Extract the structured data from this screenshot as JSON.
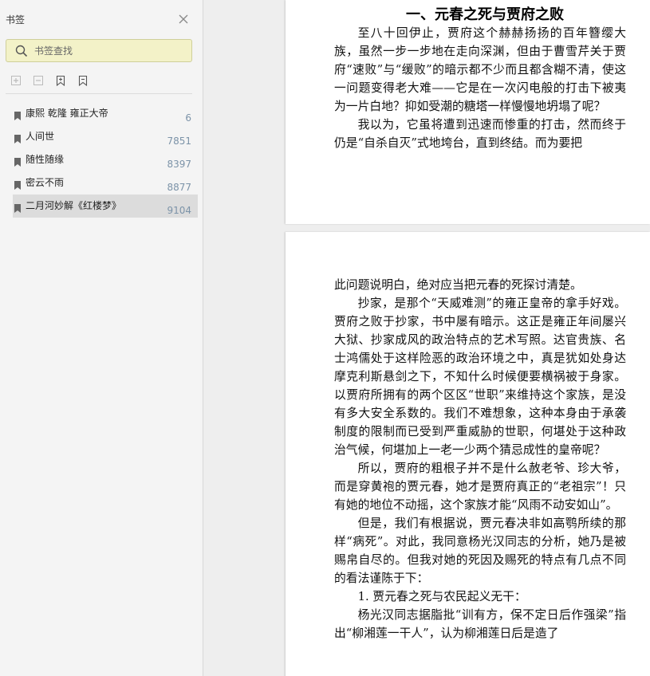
{
  "sidebar": {
    "title": "书签",
    "search_placeholder": "书签查找",
    "bookmarks": [
      {
        "label": "康熙 乾隆 雍正大帝",
        "page": "6"
      },
      {
        "label": "人间世",
        "page": "7851"
      },
      {
        "label": "随性随缘",
        "page": "8397"
      },
      {
        "label": "密云不雨",
        "page": "8877"
      },
      {
        "label": "二月河妙解《红楼梦》",
        "page": "9104"
      }
    ]
  },
  "page1": {
    "title": "一、元春之死与贾府之败",
    "paragraphs": [
      "至八十回伊止，贾府这个赫赫扬扬的百年簪缨大族，虽然一步一步地在走向深渊，但由于曹雪芹关于贾府“速败”与“缓败”的暗示都不少而且都含糊不清，使这一问题变得老大难——它是在一次闪电般的打击下被夷为一片白地？抑如受潮的糖塔一样慢慢地坍塌了呢？",
      "我以为，它虽将遭到迅速而惨重的打击，然而终于仍是“自杀自灭”式地垮台，直到终结。而为要把"
    ]
  },
  "page2": {
    "continuation": "此问题说明白，绝对应当把元春的死探讨清楚。",
    "paragraphs": [
      "抄家，是那个“天威难测”的雍正皇帝的拿手好戏。贾府之败于抄家，书中屡有暗示。这正是雍正年间屡兴大狱、抄家成风的政治特点的艺术写照。达官贵族、名士鸿儒处于这样险恶的政治环境之中，真是犹如处身达摩克利斯悬剑之下，不知什么时候便要横祸被于身家。以贾府所拥有的两个区区“世职”来维持这个家族，是没有多大安全系数的。我们不难想象，这种本身由于承袭制度的限制而已受到严重威胁的世职，何堪处于这种政治气候，何堪加上一老一少两个猜忌成性的皇帝呢？",
      "所以，贾府的粗根子并不是什么赦老爷、珍大爷，而是穿黄袍的贾元春，她才是贾府真正的“老祖宗”！只有她的地位不动摇，这个家族才能“风雨不动安如山”。",
      "但是，我们有根据说，贾元春决非如高鹗所续的那样“病死”。对此，我同意杨光汉同志的分析，她乃是被赐帛自尽的。但我对她的死因及赐死的特点有几点不同的看法谨陈于下：",
      "1. 贾元春之死与农民起义无干：",
      "杨光汉同志据脂批“训有方，保不定日后作强梁”指出“柳湘莲一干人”，认为柳湘莲日后是造了"
    ]
  }
}
